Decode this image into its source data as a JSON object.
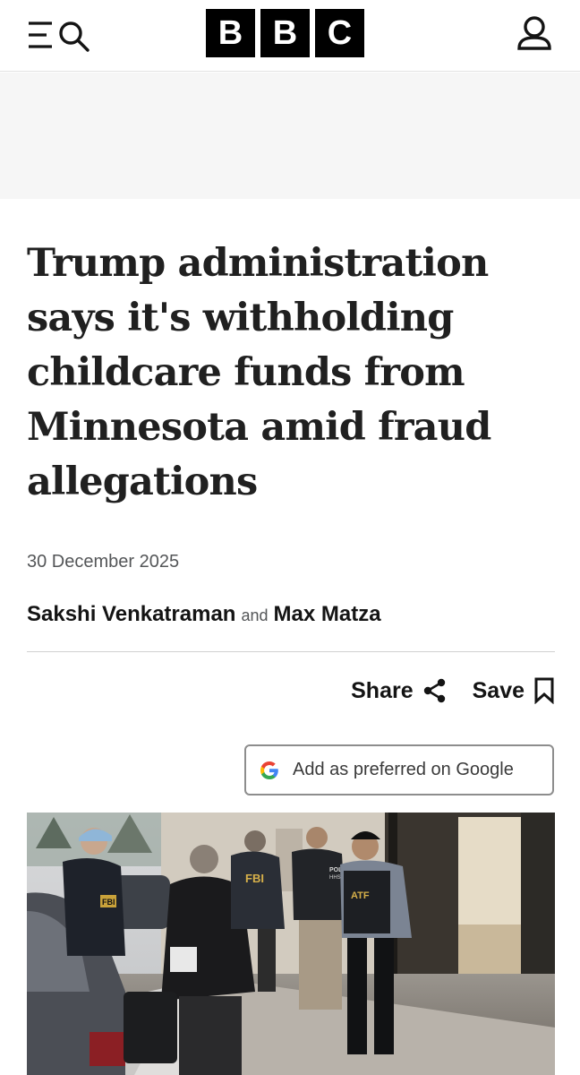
{
  "header": {
    "logo_letters": [
      "B",
      "B",
      "C"
    ],
    "menu_icon": "menu-icon",
    "search_icon": "search-icon",
    "account_icon": "account-icon"
  },
  "article": {
    "headline": "Trump administration says it's withholding childcare funds from Minnesota amid fraud allegations",
    "date": "30 December 2025",
    "byline": {
      "author_1": "Sakshi Venkatraman",
      "joiner": "and",
      "author_2": "Max Matza"
    },
    "share_label": "Share",
    "save_label": "Save",
    "google_button_label": "Add as preferred on Google"
  },
  "photo": {
    "signs": {
      "fbi_1": "FBI",
      "fbi_2": "FBI",
      "police": "POLICE",
      "hhs": "HHS-OIG",
      "atf": "ATF"
    }
  },
  "colors": {
    "brand_black": "#000000",
    "text": "#141414",
    "muted": "#545658",
    "ad_background": "#f6f6f6",
    "google_blue": "#4285F4",
    "google_red": "#EA4335",
    "google_yellow": "#FBBC05",
    "google_green": "#34A853"
  }
}
